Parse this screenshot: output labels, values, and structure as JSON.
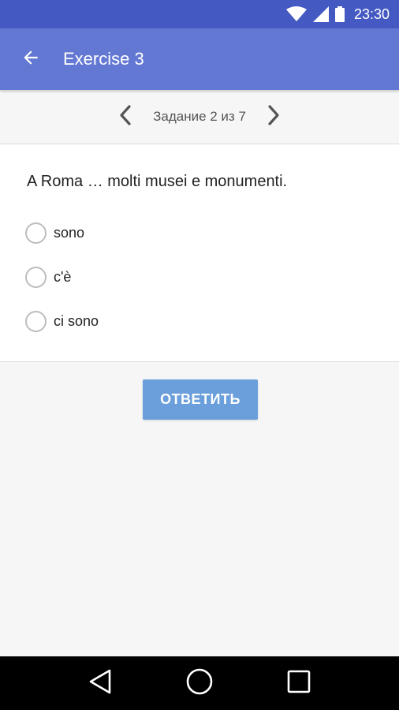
{
  "status_bar": {
    "time": "23:30",
    "icons": [
      "wifi-icon",
      "signal-icon",
      "battery-icon"
    ]
  },
  "app_bar": {
    "title": "Exercise 3",
    "back_icon": "arrow-left-icon"
  },
  "pager": {
    "label": "Задание 2 из 7",
    "prev_icon": "chevron-left-icon",
    "next_icon": "chevron-right-icon"
  },
  "question": {
    "text": "A Roma … molti musei e monumenti.",
    "options": [
      {
        "label": "sono",
        "selected": false
      },
      {
        "label": "c'è",
        "selected": false
      },
      {
        "label": "ci sono",
        "selected": false
      }
    ]
  },
  "answer_button": {
    "label": "ОТВЕТИТЬ"
  },
  "colors": {
    "status_bar": "#4459c2",
    "app_bar": "#6378d3",
    "button": "#6a9fdb"
  }
}
